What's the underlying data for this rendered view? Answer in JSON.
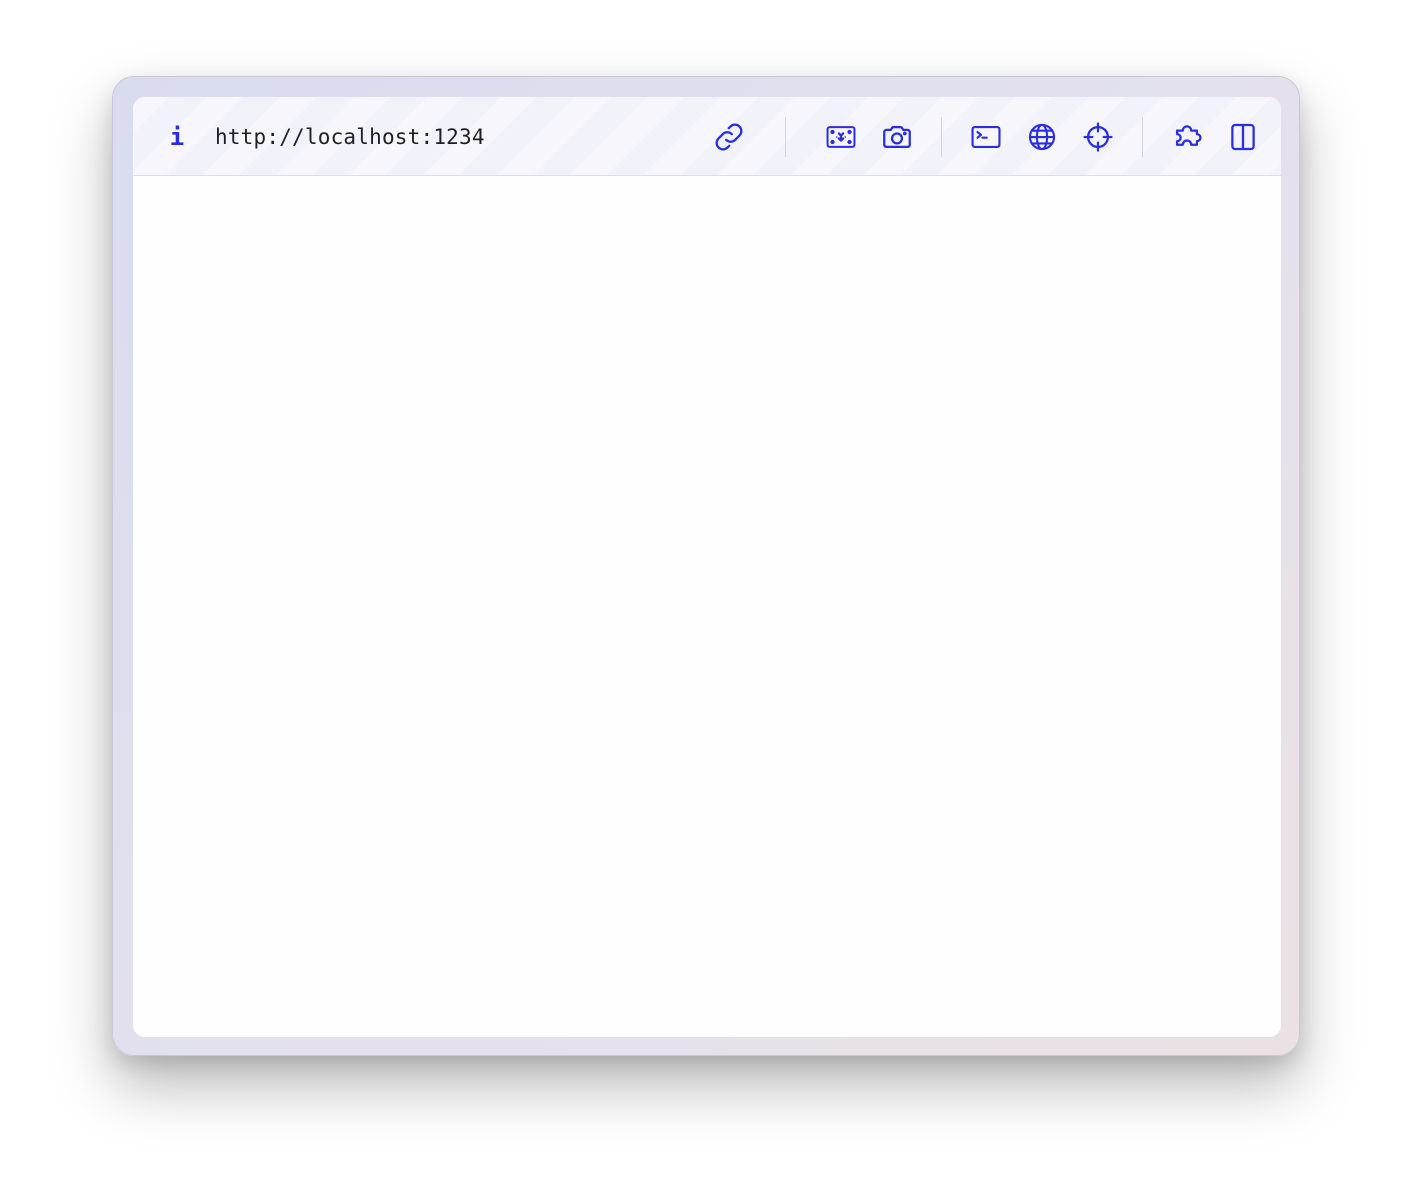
{
  "toolbar": {
    "url": "http://localhost:1234",
    "info_glyph": "i",
    "accent_color": "#2a2ee0",
    "icons": [
      "info-icon",
      "link-icon",
      "image-icon",
      "camera-icon",
      "terminal-icon",
      "globe-icon",
      "crosshair-icon",
      "puzzle-icon",
      "sidebar-icon"
    ]
  }
}
